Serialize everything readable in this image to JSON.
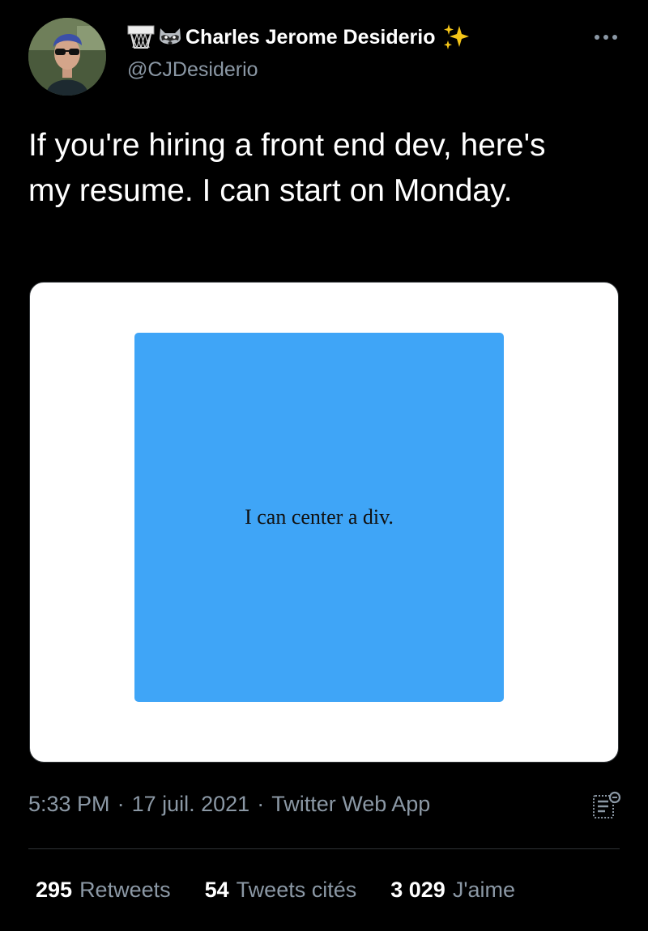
{
  "user": {
    "display_name": "Charles Jerome Desiderio",
    "handle": "@CJDesiderio",
    "name_icons": [
      "basketball-hoop-icon",
      "raccoon-icon"
    ],
    "badge_icon": "sparkles-icon"
  },
  "tweet": {
    "text": "If you're hiring a front end dev, here's my resume. I can start on Monday.",
    "image_text": "I can center a div.",
    "image_box_color": "#3fa5f7"
  },
  "meta": {
    "time": "5:33 PM",
    "separator": "·",
    "date": "17 juil. 2021",
    "source": "Twitter Web App"
  },
  "stats": [
    {
      "count": "295",
      "label": "Retweets"
    },
    {
      "count": "54",
      "label": "Tweets cités"
    },
    {
      "count": "3 029",
      "label": "J'aime"
    }
  ],
  "colors": {
    "background": "#000000",
    "primary_text": "#ffffff",
    "secondary_text": "#8b98a5",
    "divider": "#2f3336"
  }
}
